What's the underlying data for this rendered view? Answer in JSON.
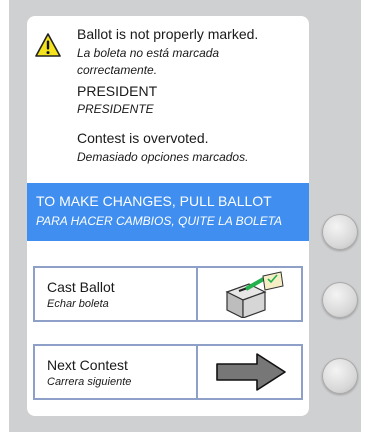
{
  "warning": {
    "icon": "warning-icon",
    "title_en": "Ballot is not properly marked.",
    "title_es_line1": "La boleta no está marcada",
    "title_es_line2": "correctamente.",
    "contest_en": "PRESIDENT",
    "contest_es": "PRESIDENTE",
    "status_en": "Contest is overvoted.",
    "status_es": "Demasiado opciones marcados."
  },
  "banner": {
    "text_en": "TO MAKE CHANGES, PULL BALLOT",
    "text_es": "PARA HACER CAMBIOS, QUITE LA BOLETA",
    "color": "#3f8ef0"
  },
  "options": [
    {
      "label_en": "Cast Ballot",
      "label_es": "Echar boleta",
      "icon": "ballot-box-icon"
    },
    {
      "label_en": "Next Contest",
      "label_es": "Carrera siguiente",
      "icon": "arrow-right-icon"
    }
  ],
  "hardware_buttons": [
    "banner-side-button",
    "cast-ballot-side-button",
    "next-contest-side-button"
  ]
}
